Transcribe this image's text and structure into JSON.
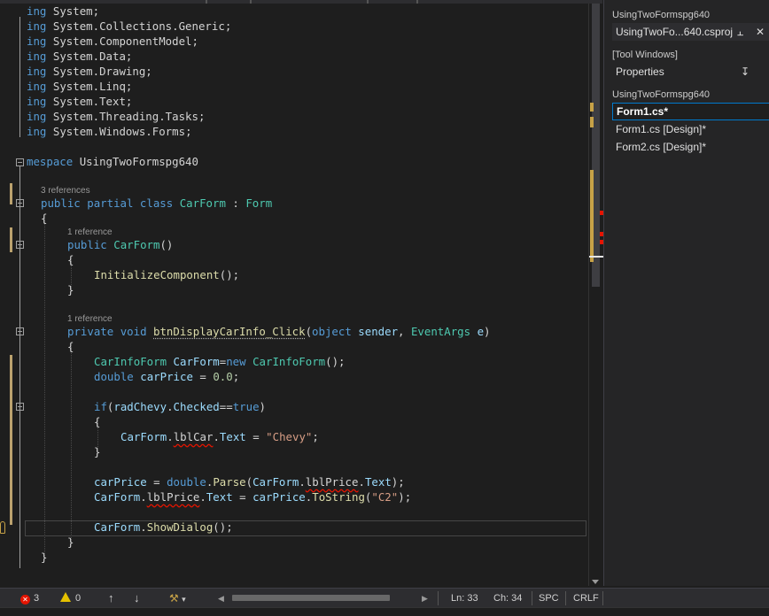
{
  "editor": {
    "usings": [
      {
        "ns": "System"
      },
      {
        "ns": "System.Collections.Generic"
      },
      {
        "ns": "System.ComponentModel"
      },
      {
        "ns": "System.Data"
      },
      {
        "ns": "System.Drawing"
      },
      {
        "ns": "System.Linq"
      },
      {
        "ns": "System.Text"
      },
      {
        "ns": "System.Threading.Tasks"
      },
      {
        "ns": "System.Windows.Forms"
      }
    ],
    "using_kw": "ing",
    "namespace_kw": "mespace",
    "namespace_name": "UsingTwoFormspg640",
    "lens_class": "3 references",
    "lens_ctor": "1 reference",
    "lens_method": "1 reference",
    "kw_public": "public",
    "kw_partial": "partial",
    "kw_class": "class",
    "class_name": "CarForm",
    "base_class": "Form",
    "ctor_name": "CarForm",
    "init_call": "InitializeComponent",
    "kw_private": "private",
    "kw_void": "void",
    "method_name": "btnDisplayCarInfo_Click",
    "kw_object": "object",
    "param_sender": "sender",
    "type_eventargs": "EventArgs",
    "param_e": "e",
    "type_carinfoform": "CarInfoForm",
    "var_carform": "CarForm",
    "kw_new": "new",
    "kw_double": "double",
    "var_carprice": "carPrice",
    "literal_zero": "0.0",
    "kw_if": "if",
    "rad_chevy": "radChevy",
    "prop_checked": "Checked",
    "kw_true": "true",
    "lbl_car": "lblCar",
    "prop_text": "Text",
    "str_chevy": "\"Chevy\"",
    "fn_parse": "Parse",
    "lbl_price": "lblPrice",
    "fn_tostring": "ToString",
    "str_c2": "\"C2\"",
    "fn_showdialog": "ShowDialog"
  },
  "panel": {
    "project_header": "UsingTwoFormspg640",
    "project_tab": "UsingTwoFo...640.csproj",
    "tool_windows_header": "[Tool Windows]",
    "properties": "Properties",
    "project_header2": "UsingTwoFormspg640",
    "items": [
      "Form1.cs*",
      "Form1.cs [Design]*",
      "Form2.cs [Design]*"
    ]
  },
  "status": {
    "errors": "3",
    "warnings": "0",
    "line": "Ln: 33",
    "col": "Ch: 34",
    "spacing": "SPC",
    "eol": "CRLF"
  },
  "colors": {
    "keyword": "#569cd6",
    "type": "#4ec9b0",
    "method": "#dcdcaa",
    "variable": "#9cdcfe",
    "string": "#d69d85",
    "error": "#e51400",
    "accent": "#007acc"
  }
}
